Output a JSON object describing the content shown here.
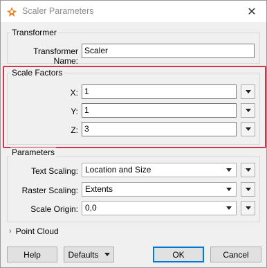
{
  "window": {
    "title": "Scaler Parameters",
    "close_glyph": "✕"
  },
  "icons": {
    "app": "fme-app-icon",
    "close": "close-icon"
  },
  "colors": {
    "highlight": "#d0334a",
    "default_button_border": "#0078d7"
  },
  "transformer": {
    "group_label": "Transformer",
    "name_label": "Transformer Name:",
    "name_value": "Scaler"
  },
  "scale_factors": {
    "group_label": "Scale Factors",
    "x_label": "X:",
    "x_value": "1",
    "y_label": "Y:",
    "y_value": "1",
    "z_label": "Z:",
    "z_value": "3"
  },
  "parameters": {
    "group_label": "Parameters",
    "text_scaling_label": "Text Scaling:",
    "text_scaling_value": "Location and Size",
    "raster_scaling_label": "Raster Scaling:",
    "raster_scaling_value": "Extents",
    "scale_origin_label": "Scale Origin:",
    "scale_origin_value": "0,0"
  },
  "point_cloud": {
    "label": "Point Cloud"
  },
  "buttons": {
    "help": "Help",
    "defaults": "Defaults",
    "ok": "OK",
    "cancel": "Cancel"
  }
}
